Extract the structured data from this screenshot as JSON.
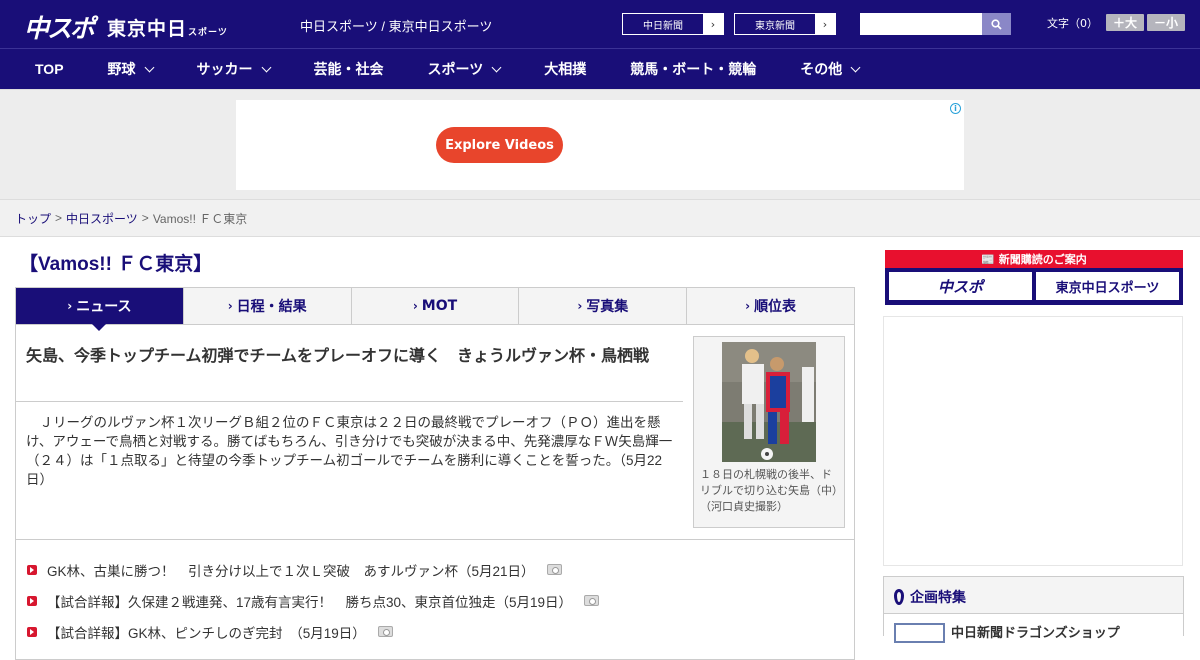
{
  "header": {
    "logo_chuspo": "中スポ",
    "logo_tokyo": "東京中日",
    "logo_tokyo_sub": "スポーツ",
    "site_name": "中日スポーツ / 東京中日スポーツ",
    "ext_link_1": "中日新聞",
    "ext_link_2": "東京新聞",
    "search_placeholder": "",
    "font_label": "文字（0）",
    "font_plus": "＋大",
    "font_minus": "－小"
  },
  "nav": {
    "items": [
      {
        "label": "TOP",
        "dropdown": false
      },
      {
        "label": "野球",
        "dropdown": true
      },
      {
        "label": "サッカー",
        "dropdown": true
      },
      {
        "label": "芸能・社会",
        "dropdown": false
      },
      {
        "label": "スポーツ",
        "dropdown": true
      },
      {
        "label": "大相撲",
        "dropdown": false
      },
      {
        "label": "競馬・ボート・競輪",
        "dropdown": false
      },
      {
        "label": "その他",
        "dropdown": true
      }
    ]
  },
  "ad": {
    "button_label": "Explore Videos",
    "info_icon": "i"
  },
  "breadcrumb": {
    "home": "トップ",
    "sep": ">",
    "section": "中日スポーツ",
    "current": "Vamos!! ＦＣ東京"
  },
  "main": {
    "section_title": "【Vamos!! ＦＣ東京】",
    "tabs": [
      {
        "label": "ニュース",
        "active": true
      },
      {
        "label": "日程・結果",
        "active": false
      },
      {
        "label": "MOT",
        "active": false
      },
      {
        "label": "写真集",
        "active": false
      },
      {
        "label": "順位表",
        "active": false
      }
    ],
    "headline": "矢島、今季トップチーム初弾でチームをプレーオフに導く　きょうルヴァン杯・鳥栖戦",
    "lead": "Ｊリーグのルヴァン杯１次リーグＢ組２位のＦＣ東京は２２日の最終戦でプレーオフ（ＰＯ）進出を懸け、アウェーで鳥栖と対戦する。勝てばもちろん、引き分けでも突破が決まる中、先発濃厚なＦＷ矢島輝一（２４）は「１点取る」と待望の今季トップチーム初ゴールでチームを勝利に導くことを誓った。（5月22日）",
    "photo_caption": "１８日の札幌戦の後半、ドリブルで切り込む矢島（中）（河口貞史撮影）",
    "news": [
      "GK林、古巣に勝つ！　引き分け以上で１次Ｌ突破　あすルヴァン杯（5月21日）",
      "【試合詳報】久保建２戦連発、17歳有言実行！　勝ち点30、東京首位独走（5月19日）",
      "【試合詳報】GK林、ピンチしのぎ完封　（5月19日）"
    ]
  },
  "sidebar": {
    "subscribe_label": "新聞購読のご案内",
    "sub_btn_1": "中スポ",
    "sub_btn_2": "東京中日スポーツ",
    "feature_title": "企画特集",
    "feature_item": "中日新聞ドラゴンズショップ"
  },
  "colors": {
    "brand_navy": "#190e78",
    "accent_red": "#e8102e",
    "ad_button": "#e8452c"
  }
}
